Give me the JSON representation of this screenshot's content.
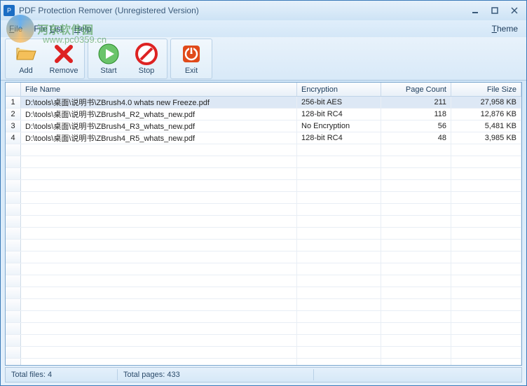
{
  "window": {
    "title": "PDF Protection Remover (Unregistered Version)"
  },
  "menus": {
    "file": "File",
    "filelist": "File List",
    "help": "Help",
    "theme": "Theme"
  },
  "toolbar": {
    "add": "Add",
    "remove": "Remove",
    "start": "Start",
    "stop": "Stop",
    "exit": "Exit"
  },
  "columns": {
    "filename": "File Name",
    "encryption": "Encryption",
    "pagecount": "Page Count",
    "filesize": "File Size"
  },
  "rows": [
    {
      "num": "1",
      "name": "D:\\tools\\桌面\\说明书\\ZBrush4.0  whats new  Freeze.pdf",
      "enc": "256-bit AES",
      "pages": "211",
      "size": "27,958 KB",
      "selected": true
    },
    {
      "num": "2",
      "name": "D:\\tools\\桌面\\说明书\\ZBrush4_R2_whats_new.pdf",
      "enc": "128-bit RC4",
      "pages": "118",
      "size": "12,876 KB",
      "selected": false
    },
    {
      "num": "3",
      "name": "D:\\tools\\桌面\\说明书\\ZBrush4_R3_whats_new.pdf",
      "enc": "No Encryption",
      "pages": "56",
      "size": "5,481 KB",
      "selected": false
    },
    {
      "num": "4",
      "name": "D:\\tools\\桌面\\说明书\\ZBrush4_R5_whats_new.pdf",
      "enc": "128-bit RC4",
      "pages": "48",
      "size": "3,985 KB",
      "selected": false
    }
  ],
  "status": {
    "files": "Total files: 4",
    "pages": "Total pages: 433"
  },
  "watermark": {
    "text": "河东软件园",
    "url": "www.pc0359.cn"
  }
}
